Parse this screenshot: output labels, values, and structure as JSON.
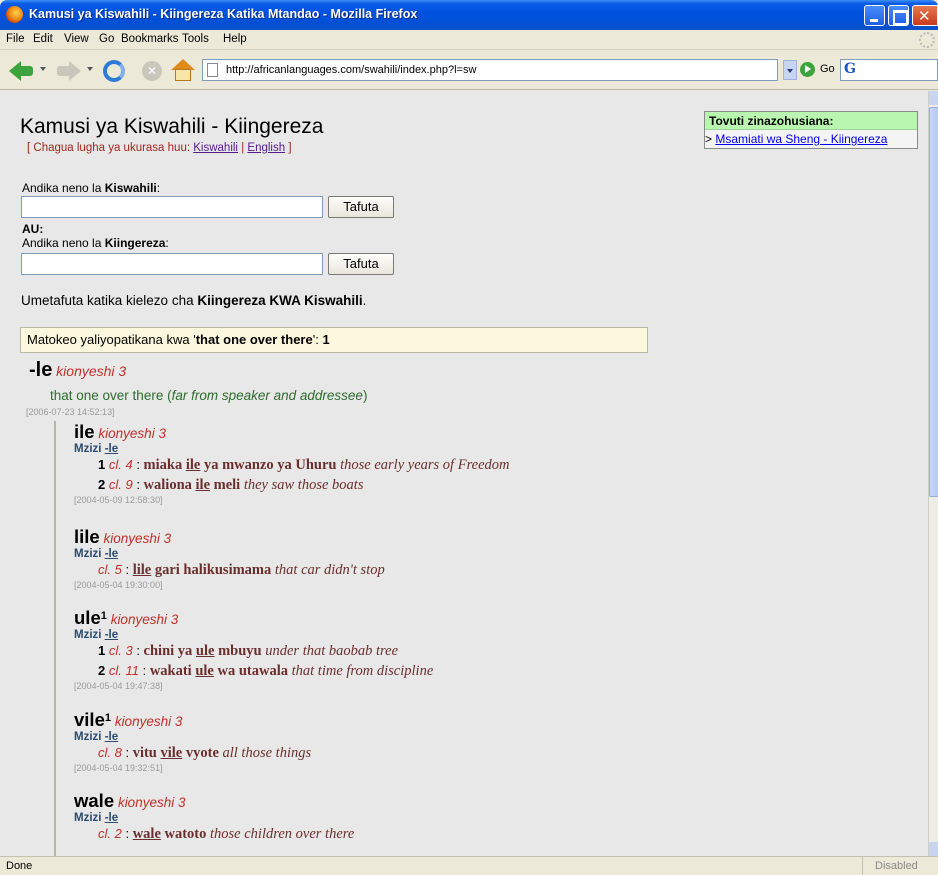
{
  "window": {
    "title": "Kamusi ya Kiswahili - Kiingereza Katika Mtandao - Mozilla Firefox"
  },
  "menu": [
    "File",
    "Edit",
    "View",
    "Go",
    "Bookmarks",
    "Tools",
    "Help"
  ],
  "toolbar": {
    "url": "http://africanlanguages.com/swahili/index.php?l=sw",
    "go_label": "Go",
    "search_engine_icon": "G"
  },
  "page": {
    "title": "Kamusi ya Kiswahili - Kiingereza",
    "lang_prefix": "[ Chagua lugha ya ukurasa huu:",
    "lang_swahili": "Kiswahili",
    "lang_sep": "|",
    "lang_english": "English",
    "lang_suffix": "]",
    "related": {
      "heading": "Tovuti zinazohusiana:",
      "arrow": ">",
      "link": "Msamiati wa Sheng - Kiingereza"
    },
    "form": {
      "sw_label_prefix": "Andika neno la ",
      "sw_label_bold": "Kiswahili",
      "sw_label_suffix": ":",
      "sw_value": "",
      "or_label": "AU:",
      "en_label_prefix": "Andika neno la ",
      "en_label_bold": "Kiingereza",
      "en_label_suffix": ":",
      "en_value": "",
      "button_label": "Tafuta"
    },
    "mode_prefix": "Umetafuta katika kielezo cha ",
    "mode_bold": "Kiingereza KWA Kiswahili",
    "mode_suffix": ".",
    "results": {
      "prefix": "Matokeo yaliyopatikana kwa '",
      "query": "that one over there",
      "middle": "': ",
      "count": "1"
    }
  },
  "root_entry": {
    "headword": "-le",
    "pos": "kionyeshi 3",
    "definition": "that one over there (",
    "definition_italic": "far from speaker and addressee",
    "definition_end": ")",
    "date": "[2006-07-23 14:52:13]"
  },
  "derived": [
    {
      "headword": "ile",
      "sup": "",
      "pos": "kionyeshi 3",
      "mzizi_label": "Mzizi",
      "mzizi_link": "-le",
      "examples": [
        {
          "num": "1",
          "cl": "cl. 4",
          "sep": " : ",
          "sw_before": "miaka ",
          "sw_key": "ile",
          "sw_after": " ya mwanzo ya Uhuru",
          "en": "those early years of Freedom"
        },
        {
          "num": "2",
          "cl": "cl. 9",
          "sep": " : ",
          "sw_before": "waliona ",
          "sw_key": "ile",
          "sw_after": " meli",
          "en": "they saw those boats"
        }
      ],
      "date": "[2004-05-09 12:58:30]"
    },
    {
      "headword": "lile",
      "sup": "",
      "pos": "kionyeshi 3",
      "mzizi_label": "Mzizi",
      "mzizi_link": "-le",
      "examples": [
        {
          "num": "",
          "cl": "cl. 5",
          "sep": " : ",
          "sw_before": "",
          "sw_key": "lile",
          "sw_after": " gari halikusimama",
          "en": "that car didn't stop"
        }
      ],
      "date": "[2004-05-04 19:30:00]"
    },
    {
      "headword": "ule",
      "sup": "1",
      "pos": "kionyeshi 3",
      "mzizi_label": "Mzizi",
      "mzizi_link": "-le",
      "examples": [
        {
          "num": "1",
          "cl": "cl. 3",
          "sep": " : ",
          "sw_before": "chini ya ",
          "sw_key": "ule",
          "sw_after": " mbuyu",
          "en": "under that baobab tree"
        },
        {
          "num": "2",
          "cl": "cl. 11",
          "sep": " : ",
          "sw_before": "wakati ",
          "sw_key": "ule",
          "sw_after": " wa utawala",
          "en": "that time from discipline"
        }
      ],
      "date": "[2004-05-04 19:47:38]"
    },
    {
      "headword": "vile",
      "sup": "1",
      "pos": "kionyeshi 3",
      "mzizi_label": "Mzizi",
      "mzizi_link": "-le",
      "examples": [
        {
          "num": "",
          "cl": "cl. 8",
          "sep": " : ",
          "sw_before": "vitu ",
          "sw_key": "vile",
          "sw_after": " vyote",
          "en": "all those things"
        }
      ],
      "date": "[2004-05-04 19:32:51]"
    },
    {
      "headword": "wale",
      "sup": "",
      "pos": "kionyeshi 3",
      "mzizi_label": "Mzizi",
      "mzizi_link": "-le",
      "examples": [
        {
          "num": "",
          "cl": "cl. 2",
          "sep": " : ",
          "sw_before": "",
          "sw_key": "wale",
          "sw_after": " watoto",
          "en": "those children over there"
        }
      ],
      "date": ""
    }
  ],
  "status": {
    "text": "Done",
    "panel": "Disabled"
  }
}
